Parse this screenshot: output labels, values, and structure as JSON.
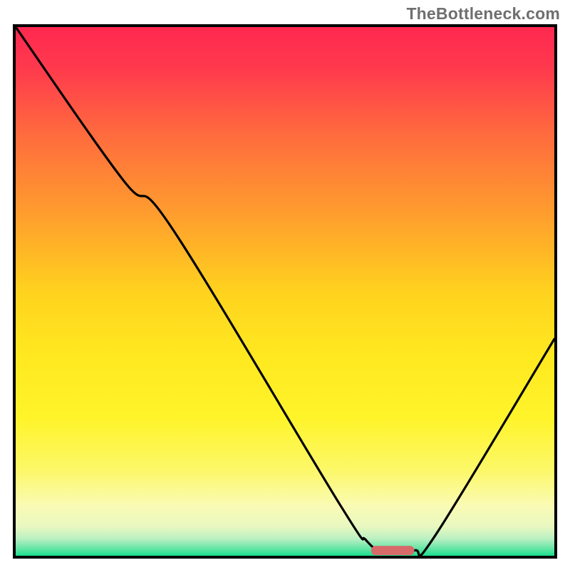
{
  "watermark": "TheBottleneck.com",
  "chart_data": {
    "type": "line",
    "title": "",
    "xlabel": "",
    "ylabel": "",
    "xlim": [
      0,
      100
    ],
    "ylim": [
      0,
      100
    ],
    "grid": false,
    "legend": false,
    "annotations": [],
    "background_gradient_stops": [
      {
        "t": 0.0,
        "color": "#ff2850"
      },
      {
        "t": 0.08,
        "color": "#ff3a4d"
      },
      {
        "t": 0.2,
        "color": "#ff6a3e"
      },
      {
        "t": 0.35,
        "color": "#ff9c2e"
      },
      {
        "t": 0.5,
        "color": "#ffd21e"
      },
      {
        "t": 0.62,
        "color": "#ffe820"
      },
      {
        "t": 0.74,
        "color": "#fff42a"
      },
      {
        "t": 0.84,
        "color": "#fcf86a"
      },
      {
        "t": 0.905,
        "color": "#fafbb4"
      },
      {
        "t": 0.945,
        "color": "#e8f8c0"
      },
      {
        "t": 0.968,
        "color": "#baf0c2"
      },
      {
        "t": 0.985,
        "color": "#6be6a8"
      },
      {
        "t": 1.0,
        "color": "#1adf8e"
      }
    ],
    "curve_points": [
      {
        "x": 0,
        "y": 100
      },
      {
        "x": 20,
        "y": 71
      },
      {
        "x": 29,
        "y": 62
      },
      {
        "x": 60,
        "y": 10
      },
      {
        "x": 65,
        "y": 3
      },
      {
        "x": 68,
        "y": 1
      },
      {
        "x": 74,
        "y": 1
      },
      {
        "x": 78,
        "y": 4
      },
      {
        "x": 100,
        "y": 41
      }
    ],
    "flat_marker": {
      "x_start": 66,
      "x_end": 74,
      "y": 1,
      "color": "#d86a6a"
    }
  }
}
